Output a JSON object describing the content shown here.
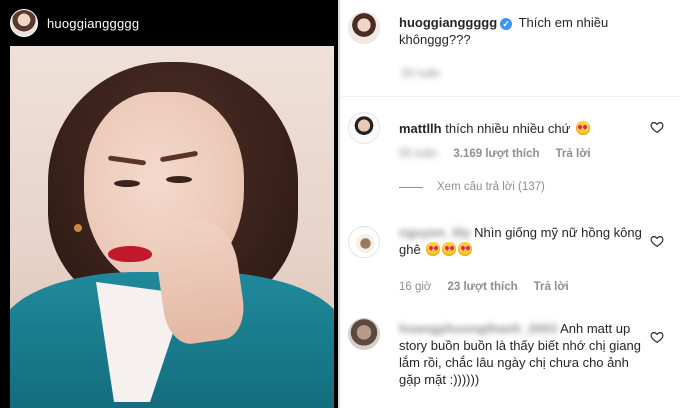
{
  "story": {
    "username": "huoggianggggg"
  },
  "caption": {
    "username": "huoggianggggg",
    "verified_mark": "✓",
    "text": "Thích em nhiều khônggg???",
    "blurred_time": "55 tuần"
  },
  "comments": [
    {
      "username": "mattllh",
      "text": "thích nhiều nhiều chứ",
      "emoji": "😍",
      "likes": "3.169 lượt thích",
      "reply_label": "Trả lời",
      "blurred_time": "55 tuần",
      "view_replies": "Xem câu trả lời (137)"
    },
    {
      "username_blurred": "nguyen_lily",
      "text": "Nhìn giống mỹ nữ hồng kông ghê",
      "emojis": [
        "😍",
        "😍",
        "😍"
      ],
      "time": "16 giờ",
      "likes": "23 lượt thích",
      "reply_label": "Trả lời"
    },
    {
      "username_blurred": "hoangphuongthanh_2003",
      "text": "Anh matt up story buồn buồn là thấy biết nhớ chị giang lắm rồi, chắc lâu ngày chị chưa cho ảnh gặp mặt :))))))"
    }
  ],
  "icons": {
    "heart": "heart-outline-icon",
    "verified": "verified-badge-icon"
  },
  "colors": {
    "text": "#262626",
    "muted": "#8e8e8e",
    "verified": "#3897f0",
    "story_bg": "#000000"
  }
}
